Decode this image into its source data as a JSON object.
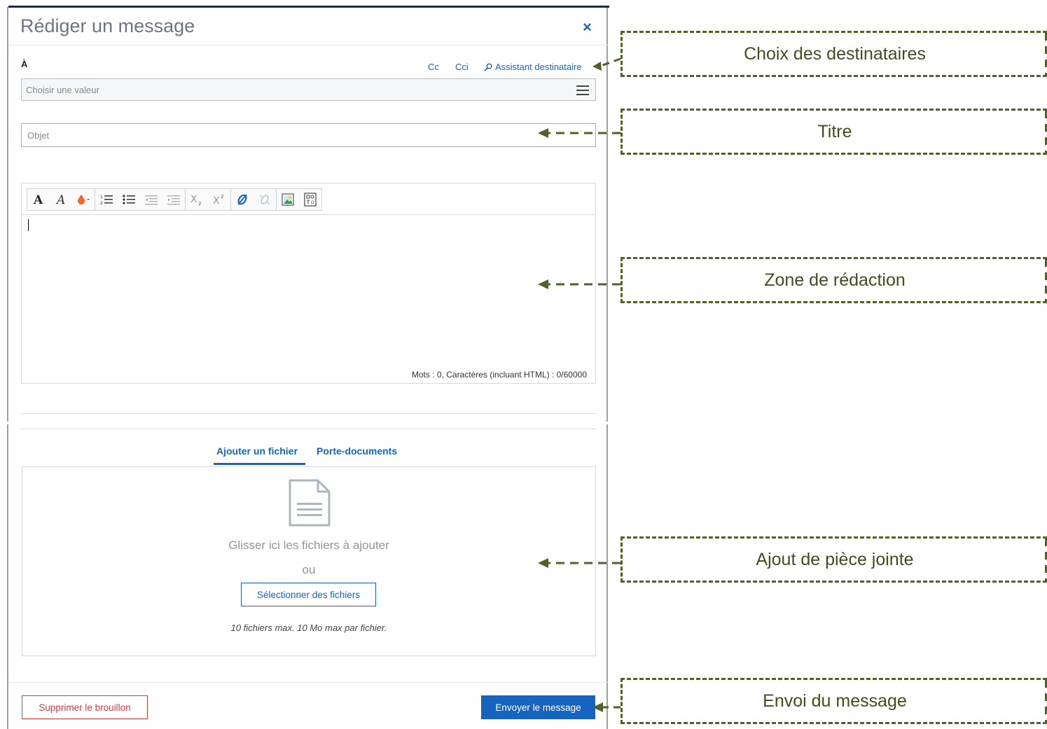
{
  "dialog": {
    "title": "Rédiger un message",
    "close_symbol": "×",
    "to_label": "À",
    "cc_label": "Cc",
    "cci_label": "Cci",
    "assistant_label": "Assistant destinataire",
    "recipients_placeholder": "Choisir une valeur",
    "subject_placeholder": "Objet",
    "subject_value": "",
    "toolbar": {
      "buttons": [
        "bold-A",
        "italic-A",
        "text-color",
        "ordered-list",
        "bullet-list",
        "outdent",
        "indent",
        "subscript",
        "superscript",
        "insert-link",
        "unlink",
        "insert-image",
        "special-insert"
      ]
    },
    "editor_counter": "Mots : 0, Caractères (incluant HTML) : 0/60000",
    "tabs": {
      "add_file": "Ajouter un fichier",
      "porte_documents": "Porte-documents"
    },
    "dropzone": {
      "main_text": "Glisser ici les fichiers à ajouter",
      "or_text": "ou",
      "select_button": "Sélectionner des fichiers",
      "limits": "10 fichiers max. 10 Mo max par fichier."
    },
    "footer": {
      "delete_draft": "Supprimer le brouillon",
      "send": "Envoyer le message"
    }
  },
  "annotations": {
    "recipients": "Choix des destinataires",
    "title": "Titre",
    "editor": "Zone de rédaction",
    "attachment": "Ajout de pièce jointe",
    "send": "Envoi du message"
  },
  "colors": {
    "accent": "#1565c0",
    "danger": "#d33c3c",
    "annotation": "#4f6228"
  }
}
